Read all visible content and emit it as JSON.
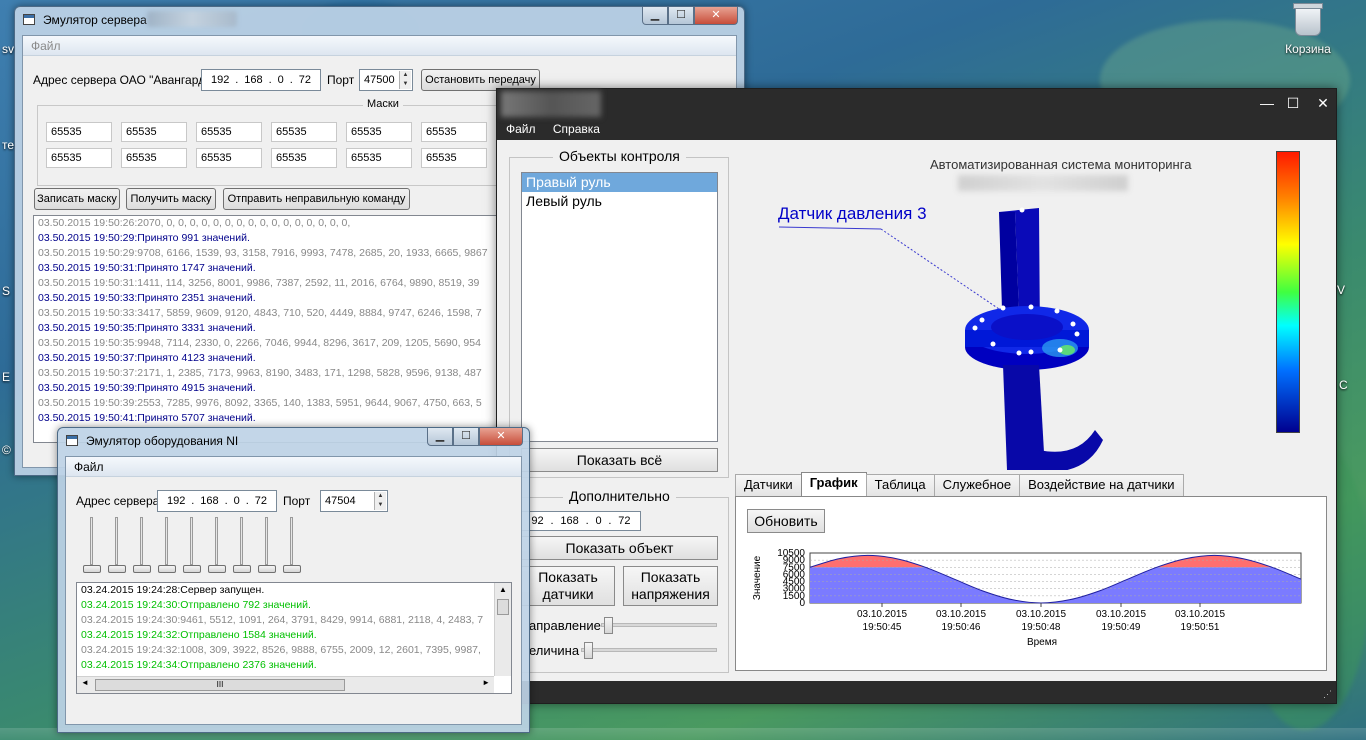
{
  "desktop": {
    "recycle_bin_label": "Корзина"
  },
  "server_window": {
    "title": "Эмулятор сервера",
    "menu": [
      "Файл"
    ],
    "address_label": "Адрес сервера ОАО \"Авангард\"",
    "ip": [
      "192",
      "168",
      "0",
      "72"
    ],
    "port_label": "Порт",
    "port_value": "47500",
    "stop_button": "Остановить передачу",
    "masks_title": "Маски",
    "masks_row1": [
      "65535",
      "65535",
      "65535",
      "65535",
      "65535",
      "65535"
    ],
    "masks_row2": [
      "65535",
      "65535",
      "65535",
      "65535",
      "65535",
      "65535"
    ],
    "write_mask_button": "Записать маску",
    "get_mask_button": "Получить маску",
    "send_wrong_button": "Отправить неправильную команду",
    "log": [
      {
        "text": "03.50.2015 19:50:26:2070, 0, 0, 0, 0, 0, 0, 0, 0, 0, 0, 0, 0, 0, 0, 0, 0,",
        "style": "gray"
      },
      {
        "text": "03.50.2015 19:50:29:Принято 991 значений.",
        "style": "blue"
      },
      {
        "text": "03.50.2015 19:50:29:9708, 6166, 1539, 93, 3158, 7916, 9993, 7478, 2685, 20, 1933, 6665, 9867",
        "style": "gray"
      },
      {
        "text": "03.50.2015 19:50:31:Принято 1747 значений.",
        "style": "blue"
      },
      {
        "text": "03.50.2015 19:50:31:1411, 114, 3256, 8001, 9986, 7387, 2592, 11, 2016, 6764, 9890, 8519, 39",
        "style": "gray"
      },
      {
        "text": "03.50.2015 19:50:33:Принято 2351 значений.",
        "style": "blue"
      },
      {
        "text": "03.50.2015 19:50:33:3417, 5859, 9609, 9120, 4843, 710, 520, 4449, 8884, 9747, 6246, 1598, 7",
        "style": "gray"
      },
      {
        "text": "03.50.2015 19:50:35:Принято 3331 значений.",
        "style": "blue"
      },
      {
        "text": "03.50.2015 19:50:35:9948, 7114, 2330, 0, 2266, 7046, 9944, 8296, 3617, 209, 1205, 5690, 954",
        "style": "gray"
      },
      {
        "text": "03.50.2015 19:50:37:Принято 4123 значений.",
        "style": "blue"
      },
      {
        "text": "03.50.2015 19:50:37:2171, 1, 2385, 7173, 9963, 8190, 3483, 171, 1298, 5828, 9596, 9138, 487",
        "style": "gray"
      },
      {
        "text": "03.50.2015 19:50:39:Принято 4915 значений.",
        "style": "blue"
      },
      {
        "text": "03.50.2015 19:50:39:2553, 7285, 9976, 8092, 3365, 140, 1383, 5951, 9644, 9067, 4750, 663, 5",
        "style": "gray"
      },
      {
        "text": "03.50.2015 19:50:41:Принято 5707 значений.",
        "style": "blue"
      }
    ]
  },
  "ni_window": {
    "title": "Эмулятор оборудования NI",
    "menu": [
      "Файл"
    ],
    "address_label": "Адрес сервера",
    "ip": [
      "192",
      "168",
      "0",
      "72"
    ],
    "port_label": "Порт",
    "port_value": "47504",
    "slider_levels": [
      0,
      0,
      0,
      0,
      0,
      0,
      0,
      0,
      0
    ],
    "log": [
      {
        "text": "03.24.2015 19:24:28:Сервер запущен.",
        "style": "black"
      },
      {
        "text": "03.24.2015 19:24:30:Отправлено 792 значений.",
        "style": "green"
      },
      {
        "text": "03.24.2015 19:24:30:9461, 5512, 1091, 264, 3791, 8429, 9914, 6881, 2118, 4, 2483, 7",
        "style": "gray"
      },
      {
        "text": "03.24.2015 19:24:32:Отправлено 1584 значений.",
        "style": "green"
      },
      {
        "text": "03.24.2015 19:24:32:1008, 309, 3922, 8526, 9888, 6755, 2009, 12, 2601, 7395, 9987,",
        "style": "gray"
      },
      {
        "text": "03.24.2015 19:24:34:Отправлено 2376 значений.",
        "style": "green"
      }
    ],
    "scroll_grip": "III"
  },
  "monitor_window": {
    "menu": [
      "Файл",
      "Справка"
    ],
    "objects_title": "Объекты контроля",
    "objects": [
      "Правый руль",
      "Левый руль"
    ],
    "selected_object": 0,
    "show_all_button": "Показать всё",
    "additional_title": "Дополнительно",
    "ip_partial": [
      "92",
      "168",
      "0",
      "72"
    ],
    "show_object_button": "Показать объект",
    "show_sensors_button": [
      "Показать",
      "датчики"
    ],
    "show_voltage_button": [
      "Показать",
      "напряжения"
    ],
    "direction_label": "аправление",
    "magnitude_label": "еличина",
    "system_title": "Автоматизированная система мониторинга",
    "sensor_label": "Датчик давления 3",
    "tabs": [
      "Датчики",
      "График",
      "Таблица",
      "Служебное",
      "Воздействие на датчики"
    ],
    "active_tab": 1,
    "refresh_button": "Обновить",
    "colors": {
      "accent": "#0000c8",
      "list_selection": "#6fa8dc",
      "title_bar": "#2b2b2b"
    }
  },
  "chart_data": {
    "type": "area",
    "title": "",
    "xlabel": "Время",
    "ylabel": "Значение",
    "ylim": [
      0,
      10500
    ],
    "yticks": [
      0,
      1500,
      3000,
      4500,
      6000,
      7500,
      9000,
      10500
    ],
    "ytick_labels": [
      "0",
      "1500",
      "3000",
      "4500",
      "6000",
      "7500",
      "9000",
      "10500"
    ],
    "xtick_labels": [
      [
        "03.10.2015",
        "19:50:45"
      ],
      [
        "03.10.2015",
        "19:50:46"
      ],
      [
        "03.10.2015",
        "19:50:48"
      ],
      [
        "03.10.2015",
        "19:50:49"
      ],
      [
        "03.10.2015",
        "19:50:51"
      ]
    ],
    "threshold": 7500,
    "series": [
      {
        "values": [
          7500,
          9300,
          10000,
          9300,
          7500,
          5000,
          2500,
          700,
          0,
          700,
          2500,
          5000,
          7500,
          9300,
          10000,
          9300,
          7500,
          5000
        ]
      }
    ],
    "colors": {
      "fill": "#7b7bff",
      "above_threshold": "#ff6f6f",
      "line": "#2020a0"
    },
    "grid": true
  }
}
